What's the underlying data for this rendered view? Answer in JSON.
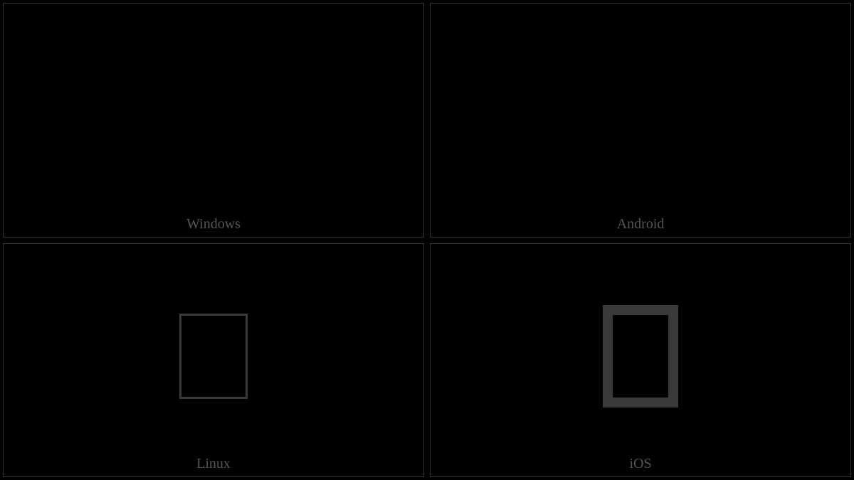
{
  "cells": [
    {
      "label": "Windows",
      "glyph": null
    },
    {
      "label": "Android",
      "glyph": null
    },
    {
      "label": "Linux",
      "glyph": "thin-box"
    },
    {
      "label": "iOS",
      "glyph": "thick-box"
    }
  ]
}
